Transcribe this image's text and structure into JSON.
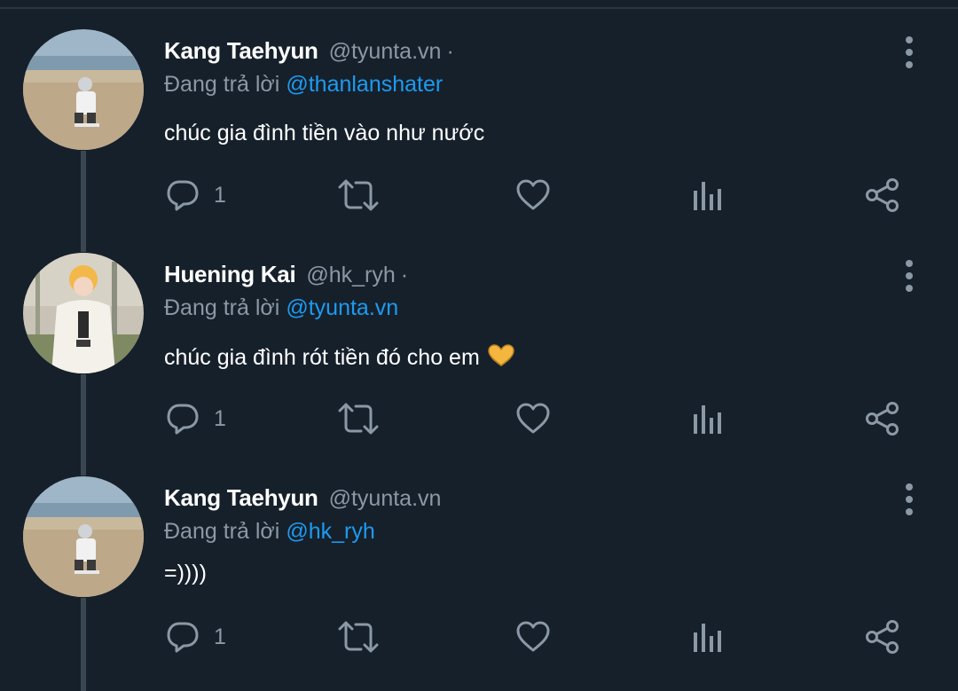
{
  "colors": {
    "background": "#16202b",
    "text_primary": "#ffffff",
    "text_secondary": "#8b98a5",
    "accent": "#1d9bf0",
    "thread_line": "#3a4651"
  },
  "reply_prefix": "Đang trả lời",
  "tweets": [
    {
      "name": "Kang Taehyun",
      "handle": "@tyunta.vn",
      "dot": "·",
      "replying_to": "@thanlanshater",
      "text": "chúc gia đình tiền vào như nước",
      "reply_count": "1",
      "avatar_icon": "avatar-photo"
    },
    {
      "name": "Huening Kai",
      "handle": "@hk_ryh",
      "dot": "·",
      "replying_to": "@tyunta.vn",
      "text": "chúc gia đình rót tiền đó cho em",
      "emoji": "heart-hands-emoji",
      "reply_count": "1",
      "avatar_icon": "avatar-photo"
    },
    {
      "name": "Kang Taehyun",
      "handle": "@tyunta.vn",
      "dot": "",
      "replying_to": "@hk_ryh",
      "text": "=))))",
      "reply_count": "1",
      "avatar_icon": "avatar-photo"
    }
  ],
  "icons": {
    "reply": "reply-icon",
    "retweet": "retweet-icon",
    "like": "heart-icon",
    "views": "bar-chart-icon",
    "share": "share-icon",
    "more": "more-vertical-icon"
  }
}
